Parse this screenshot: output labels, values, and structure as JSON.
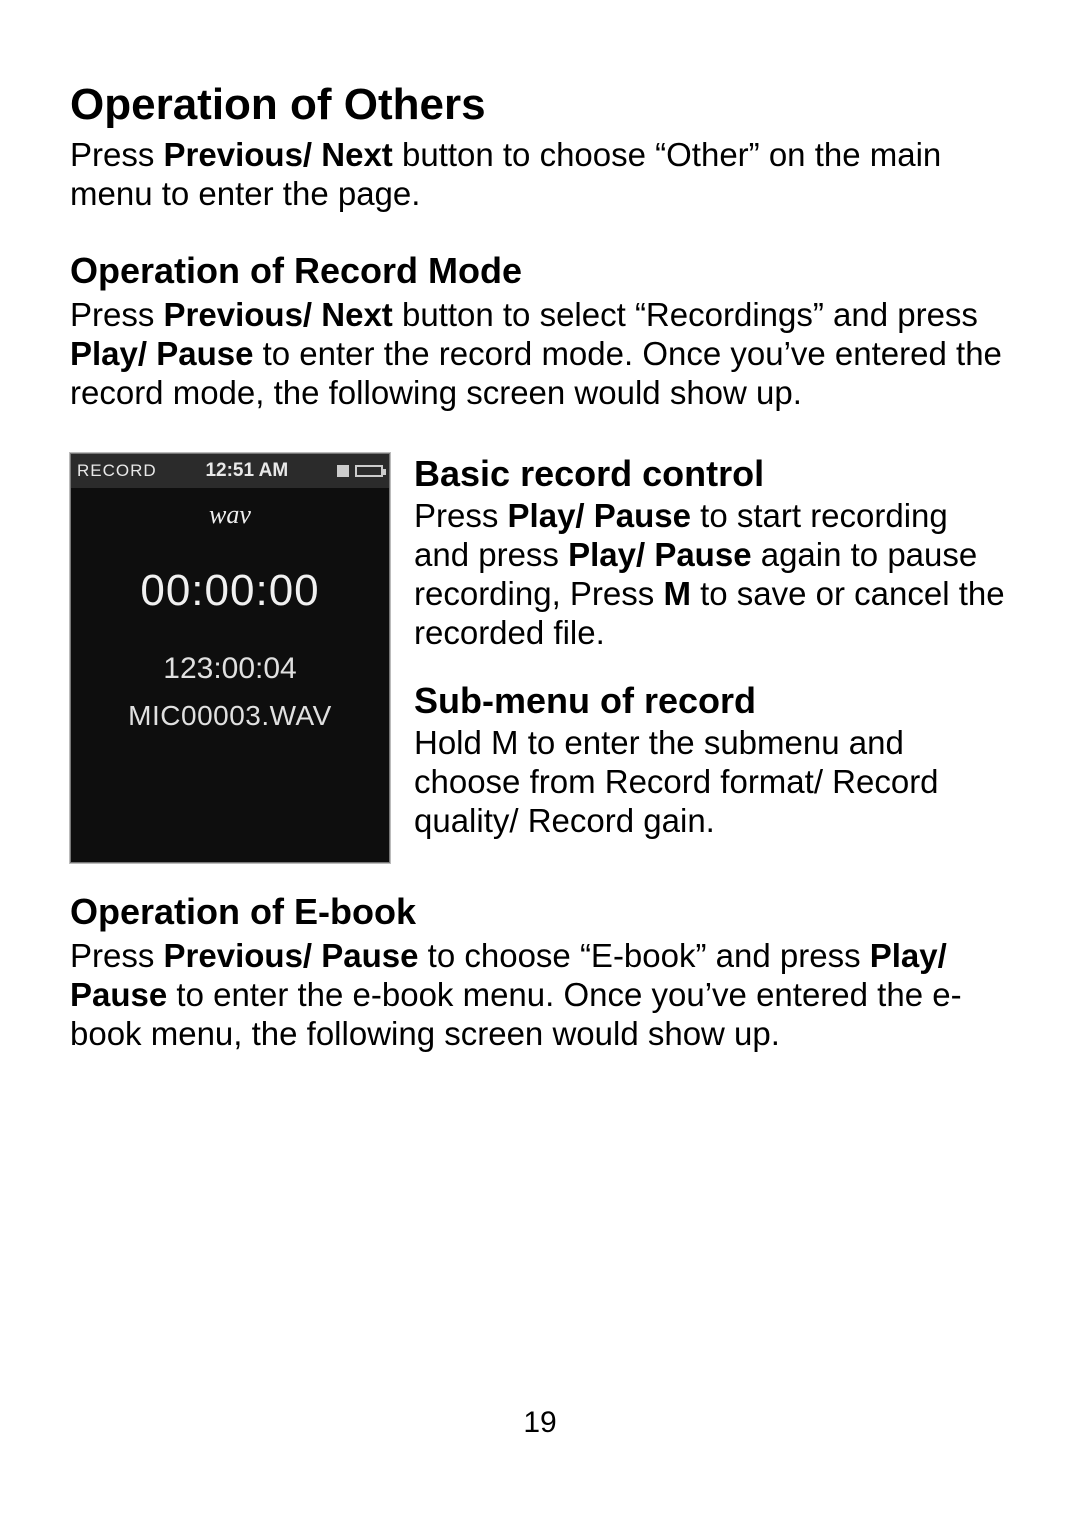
{
  "h1": "Operation of Others",
  "p1_a": "Press ",
  "p1_bold": "Previous/ Next",
  "p1_b": " button to choose “Other” on the main menu to enter the page.",
  "h2_record": "Operation of Record Mode",
  "p2_a": "Press ",
  "p2_bold1": "Previous/ Next",
  "p2_b": " button to select “Recordings” and press ",
  "p2_bold2": "Play/ Pause",
  "p2_c": " to enter the record mode. Once you’ve entered the record mode, the following screen would show up.",
  "screen": {
    "record_label": "RECORD",
    "time": "12:51 AM",
    "format": "wav",
    "elapsed": "00:00:00",
    "remaining": "123:00:04",
    "filename": "MIC00003.WAV"
  },
  "h3_basic": "Basic record control",
  "p3_a": "Press ",
  "p3_bold1": "Play/ Pause",
  "p3_b": " to start recording and press ",
  "p3_bold2": "Play/ Pause",
  "p3_c": " again to pause recording, Press ",
  "p3_bold3": "M",
  "p3_d": " to save or cancel the recorded file.",
  "h3_sub": "Sub-menu of record",
  "p4": "Hold M to enter the submenu and choose from Record format/ Record quality/ Record gain.",
  "h2_ebook": "Operation of E-book",
  "p5_a": "Press ",
  "p5_bold1": "Previous/ Pause",
  "p5_b": " to choose “E-book” and press ",
  "p5_bold2": "Play/ Pause",
  "p5_c": " to enter the e-book menu. Once you’ve entered the e-book menu, the following screen would show up.",
  "page_number": "19"
}
